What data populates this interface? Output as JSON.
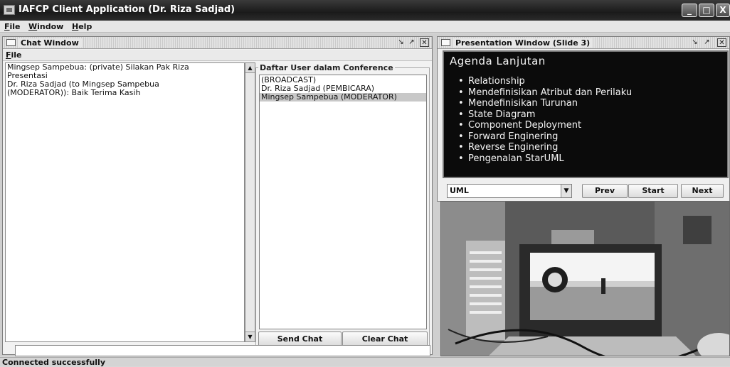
{
  "window": {
    "title": "IAFCP Client Application (Dr. Riza Sadjad)",
    "controls": {
      "minimize": "_",
      "maximize": "□",
      "close": "X"
    }
  },
  "menubar": {
    "file": {
      "mnemonic": "F",
      "rest": "ile"
    },
    "window": {
      "mnemonic": "W",
      "rest": "indow"
    },
    "help": {
      "mnemonic": "H",
      "rest": "elp"
    }
  },
  "chat": {
    "title": "Chat Window",
    "menu_file": {
      "mnemonic": "F",
      "rest": "ile"
    },
    "messages": [
      "Mingsep Sampebua: (private) Silakan Pak Riza\nPresentasi",
      "Dr. Riza Sadjad (to Mingsep Sampebua\n(MODERATOR)): Baik Terima Kasih"
    ],
    "users_label": "Daftar User dalam Conference",
    "users": [
      "(BROADCAST)",
      "Dr. Riza Sadjad (PEMBICARA)",
      "Mingsep Sampebua (MODERATOR)"
    ],
    "selected_user": "Mingsep Sampebua (MODERATOR)",
    "send_label": "Send Chat",
    "clear_label": "Clear Chat",
    "input_value": ""
  },
  "presentation": {
    "title": "Presentation Window (Slide 3)",
    "slide": {
      "title": "Agenda Lanjutan",
      "items": [
        "Relationship",
        "Mendefinisikan Atribut dan Perilaku",
        "Mendefinisikan Turunan",
        "State Diagram",
        "Component Deployment",
        "Forward Enginering",
        "Reverse Enginering",
        "Pengenalan StarUML"
      ]
    },
    "combo_value": "UML",
    "prev_label": "Prev",
    "start_label": "Start",
    "next_label": "Next"
  },
  "status": {
    "text": "Connected successfully"
  }
}
